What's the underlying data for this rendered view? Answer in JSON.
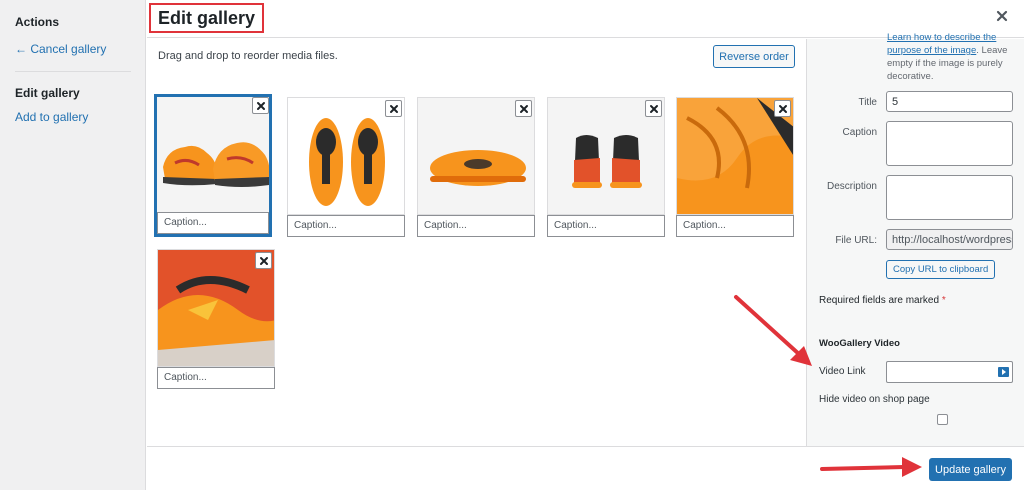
{
  "sidebar": {
    "title": "Actions",
    "cancel_link": "← Cancel gallery",
    "edit_title": "Edit gallery",
    "add_link": "Add to gallery"
  },
  "header": {
    "title": "Edit gallery"
  },
  "content": {
    "hint": "Drag and drop to reorder media files.",
    "reverse_label": "Reverse order",
    "caption_placeholder": "Caption..."
  },
  "details": {
    "alt_help_link": "Learn how to describe the purpose of the image",
    "alt_help_text": ". Leave empty if the image is purely decorative.",
    "title_label": "Title",
    "title_value": "5",
    "caption_label": "Caption",
    "description_label": "Description",
    "file_url_label": "File URL:",
    "file_url_value": "http://localhost/wordpress",
    "copy_label": "Copy URL to clipboard",
    "required_text": "Required fields are marked",
    "required_star": "*",
    "woo_title": "WooGallery Video",
    "video_link_label": "Video Link",
    "hide_video_label": "Hide video on shop page"
  },
  "footer": {
    "update_label": "Update gallery"
  },
  "colors": {
    "accent": "#2271b1",
    "highlight": "#e0333a",
    "product_orange": "#f7941d"
  },
  "icons": [
    "close-icon",
    "remove-icon",
    "play-icon",
    "arrow-annotation"
  ]
}
